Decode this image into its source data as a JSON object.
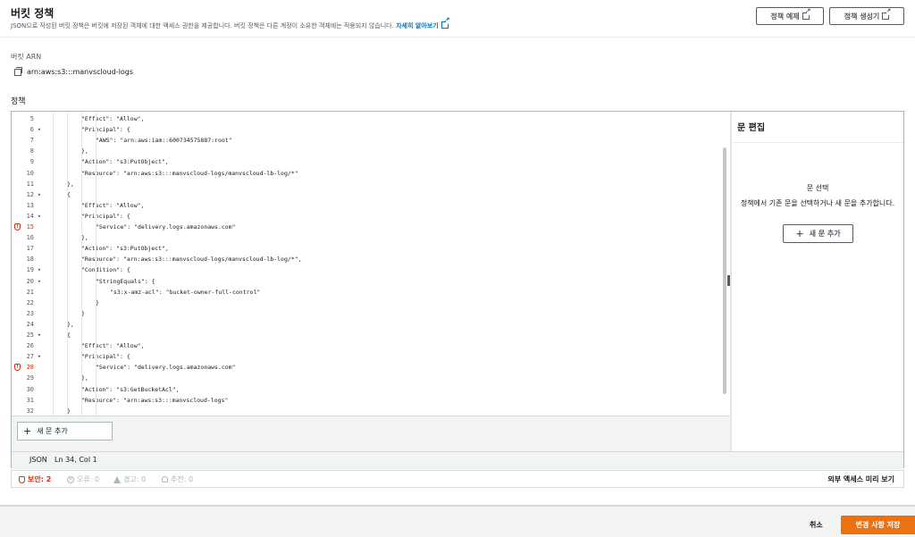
{
  "header": {
    "title": "버킷 정책",
    "description": "JSON으로 작성된 버킷 정책은 버킷에 저장된 객체에 대한 액세스 권한을 제공합니다. 버킷 정책은 다른 계정이 소유한 객체에는 적용되지 않습니다.",
    "learn_more": "자세히 알아보기",
    "delete_button": "정책 예제",
    "generator_button": "정책 생성기"
  },
  "arn": {
    "label": "버킷 ARN",
    "value": "arn:aws:s3:::manvscloud-logs"
  },
  "policy_label": "정책",
  "editor": {
    "lines": [
      {
        "n": "5",
        "fold": false,
        "warn": false,
        "indent": 4,
        "text": "\"Effect\": \"Allow\","
      },
      {
        "n": "6",
        "fold": true,
        "warn": false,
        "indent": 4,
        "text": "\"Principal\": {"
      },
      {
        "n": "7",
        "fold": false,
        "warn": false,
        "indent": 6,
        "text": "\"AWS\": \"arn:aws:iam::600734575887:root\""
      },
      {
        "n": "8",
        "fold": false,
        "warn": false,
        "indent": 4,
        "text": "},"
      },
      {
        "n": "9",
        "fold": false,
        "warn": false,
        "indent": 4,
        "text": "\"Action\": \"s3:PutObject\","
      },
      {
        "n": "10",
        "fold": false,
        "warn": false,
        "indent": 4,
        "text": "\"Resource\": \"arn:aws:s3:::manvscloud-logs/manvscloud-lb-log/*\""
      },
      {
        "n": "11",
        "fold": false,
        "warn": false,
        "indent": 2,
        "text": "},"
      },
      {
        "n": "12",
        "fold": true,
        "warn": false,
        "indent": 2,
        "text": "{"
      },
      {
        "n": "13",
        "fold": false,
        "warn": false,
        "indent": 4,
        "text": "\"Effect\": \"Allow\","
      },
      {
        "n": "14",
        "fold": true,
        "warn": false,
        "indent": 4,
        "text": "\"Principal\": {"
      },
      {
        "n": "15",
        "fold": false,
        "warn": true,
        "indent": 6,
        "text": "\"Service\": \"delivery.logs.amazonaws.com\""
      },
      {
        "n": "16",
        "fold": false,
        "warn": false,
        "indent": 4,
        "text": "},"
      },
      {
        "n": "17",
        "fold": false,
        "warn": false,
        "indent": 4,
        "text": "\"Action\": \"s3:PutObject\","
      },
      {
        "n": "18",
        "fold": false,
        "warn": false,
        "indent": 4,
        "text": "\"Resource\": \"arn:aws:s3:::manvscloud-logs/manvscloud-lb-log/*\","
      },
      {
        "n": "19",
        "fold": true,
        "warn": false,
        "indent": 4,
        "text": "\"Condition\": {"
      },
      {
        "n": "20",
        "fold": true,
        "warn": false,
        "indent": 6,
        "text": "\"StringEquals\": {"
      },
      {
        "n": "21",
        "fold": false,
        "warn": false,
        "indent": 8,
        "text": "\"s3:x-amz-acl\": \"bucket-owner-full-control\""
      },
      {
        "n": "22",
        "fold": false,
        "warn": false,
        "indent": 6,
        "text": "}"
      },
      {
        "n": "23",
        "fold": false,
        "warn": false,
        "indent": 4,
        "text": "}"
      },
      {
        "n": "24",
        "fold": false,
        "warn": false,
        "indent": 2,
        "text": "},"
      },
      {
        "n": "25",
        "fold": true,
        "warn": false,
        "indent": 2,
        "text": "{"
      },
      {
        "n": "26",
        "fold": false,
        "warn": false,
        "indent": 4,
        "text": "\"Effect\": \"Allow\","
      },
      {
        "n": "27",
        "fold": true,
        "warn": false,
        "indent": 4,
        "text": "\"Principal\": {"
      },
      {
        "n": "28",
        "fold": false,
        "warn": true,
        "indent": 6,
        "text": "\"Service\": \"delivery.logs.amazonaws.com\""
      },
      {
        "n": "29",
        "fold": false,
        "warn": false,
        "indent": 4,
        "text": "},"
      },
      {
        "n": "30",
        "fold": false,
        "warn": false,
        "indent": 4,
        "text": "\"Action\": \"s3:GetBucketAcl\","
      },
      {
        "n": "31",
        "fold": false,
        "warn": false,
        "indent": 4,
        "text": "\"Resource\": \"arn:aws:s3:::manvscloud-logs\""
      },
      {
        "n": "32",
        "fold": false,
        "warn": false,
        "indent": 2,
        "text": "}"
      }
    ],
    "add_statement": "새 문 추가",
    "status_lang": "JSON",
    "status_pos": "Ln 34, Col 1"
  },
  "side_panel": {
    "title": "문 편집",
    "select_title": "문 선택",
    "select_desc": "정책에서 기존 문을 선택하거나 새 문을 추가합니다.",
    "add_button": "새 문 추가"
  },
  "issues": {
    "security": "보안: 2",
    "errors": "오류: 0",
    "warnings": "경고: 0",
    "suggestions": "추천: 0",
    "preview": "외부 액세스 미리 보기"
  },
  "footer": {
    "cancel": "취소",
    "save": "변경 사항 저장"
  },
  "colors": {
    "accent": "#ec7211",
    "link": "#0073bb",
    "security": "#d13212"
  }
}
